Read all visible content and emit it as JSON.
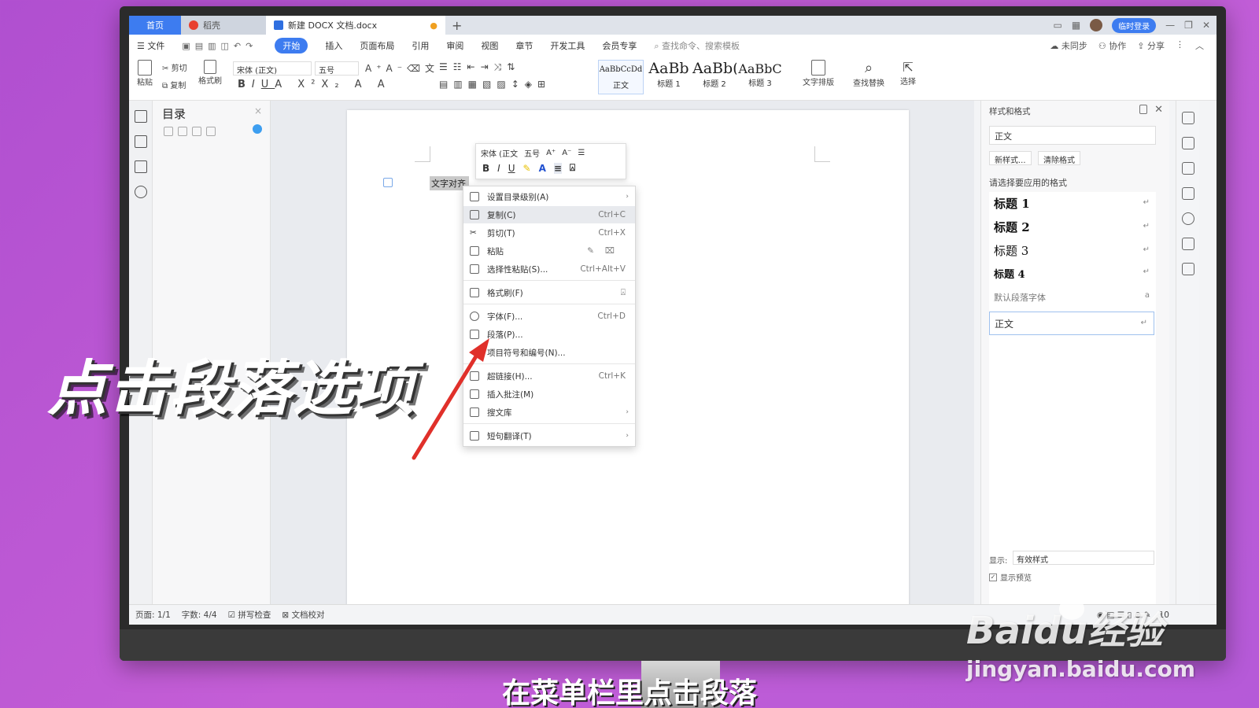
{
  "titlebar": {
    "tab_home": "首页",
    "tab_docer": "稻壳",
    "tab_doc": "新建 DOCX 文档.docx",
    "new_tab": "+",
    "login": "临时登录"
  },
  "menubar": {
    "file": "文件",
    "items": [
      "开始",
      "插入",
      "页面布局",
      "引用",
      "审阅",
      "视图",
      "章节",
      "开发工具",
      "会员专享"
    ],
    "search": "查找命令、搜索模板",
    "sync": "未同步",
    "collab": "协作",
    "share": "分享"
  },
  "ribbon": {
    "paste": "粘贴",
    "cut": "剪切",
    "copy": "复制",
    "format_painter": "格式刷",
    "font_name": "宋体 (正文)",
    "font_size": "五号",
    "styles": [
      {
        "preview": "AaBbCcDd",
        "label": "正文"
      },
      {
        "preview": "AaBb",
        "label": "标题 1"
      },
      {
        "preview": "AaBb(",
        "label": "标题 2"
      },
      {
        "preview": "AaBbC",
        "label": "标题 3"
      }
    ],
    "text_layout": "文字排版",
    "find_replace": "查找替换",
    "select": "选择"
  },
  "toc": {
    "title": "目录",
    "close": "×"
  },
  "document": {
    "selected_text": "文字对齐"
  },
  "mini_toolbar": {
    "font": "宋体 (正文",
    "size": "五号"
  },
  "context_menu": [
    {
      "label": "设置目录级别(A)",
      "shortcut": "",
      "submenu": true
    },
    {
      "label": "复制(C)",
      "shortcut": "Ctrl+C",
      "submenu": false
    },
    {
      "label": "剪切(T)",
      "shortcut": "Ctrl+X",
      "submenu": false
    },
    {
      "label": "粘贴",
      "shortcut": "",
      "submenu": false
    },
    {
      "label": "选择性粘贴(S)...",
      "shortcut": "Ctrl+Alt+V",
      "submenu": false
    },
    {
      "label": "格式刷(F)",
      "shortcut": "",
      "submenu": false
    },
    {
      "label": "字体(F)...",
      "shortcut": "Ctrl+D",
      "submenu": false
    },
    {
      "label": "段落(P)...",
      "shortcut": "",
      "submenu": false
    },
    {
      "label": "项目符号和编号(N)...",
      "shortcut": "",
      "submenu": false
    },
    {
      "label": "超链接(H)...",
      "shortcut": "Ctrl+K",
      "submenu": false
    },
    {
      "label": "插入批注(M)",
      "shortcut": "",
      "submenu": false
    },
    {
      "label": "搜文库",
      "shortcut": "",
      "submenu": true
    },
    {
      "label": "短句翻译(T)",
      "shortcut": "",
      "submenu": true
    }
  ],
  "style_panel": {
    "title": "样式和格式",
    "current_style": "正文",
    "new_style": "新样式...",
    "clear_format": "清除格式",
    "hint": "请选择要应用的格式",
    "headings": [
      "标题 1",
      "标题 2",
      "标题 3",
      "标题 4"
    ],
    "default_font": "默认段落字体",
    "normal": "正文",
    "show_label": "显示:",
    "show_value": "有效样式",
    "preview_label": "显示预览"
  },
  "statusbar": {
    "page": "页面: 1/1",
    "words": "字数: 4/4",
    "spell": "拼写检查",
    "proof": "文档校对",
    "zoom": "10"
  },
  "overlay": {
    "headline": "点击段落选项",
    "caption": "在菜单栏里点击段落",
    "watermark_brand": "Baidu经验",
    "watermark_url": "jingyan.baidu.com"
  },
  "colors": {
    "accent": "#3d7cf0",
    "background": "#c05ad5",
    "arrow": "#e0302a"
  }
}
